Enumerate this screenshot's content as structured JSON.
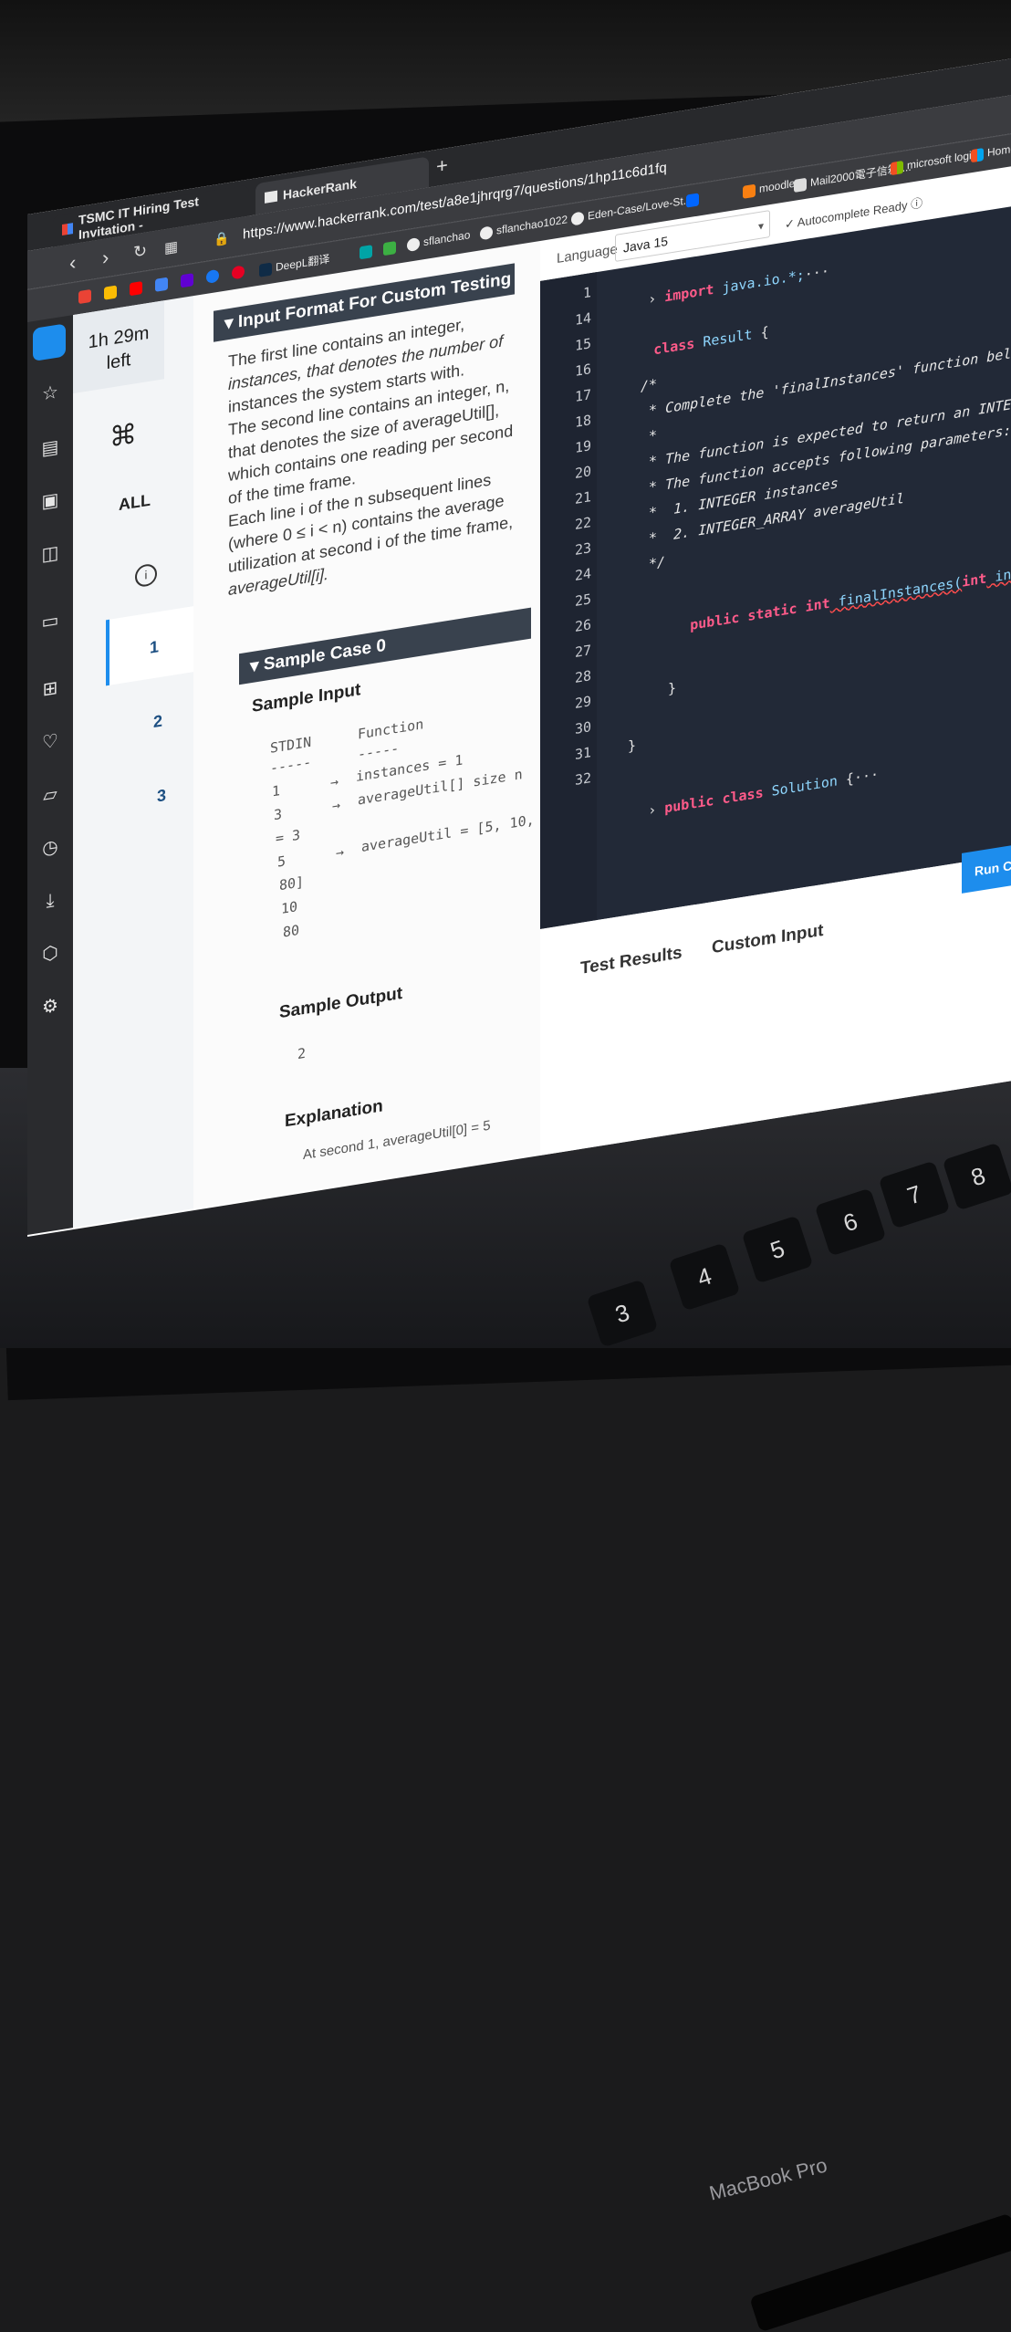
{
  "browser": {
    "tabs": [
      {
        "label": "TSMC IT Hiring Test Invitation -",
        "icon": "gmail-icon"
      },
      {
        "label": "HackerRank",
        "icon": "hackerrank-icon"
      }
    ],
    "new_tab": "+",
    "url": "https://www.hackerrank.com/test/a8e1jhrqrg7/questions/1hp11c6d1fq",
    "bookmarks": [
      "DeepL翻译",
      "sflanchao",
      "sflanchao1022",
      "Eden-Case/Love-St...",
      "moodle",
      "Mail2000電子信箱-...",
      "microsoft login",
      "Home - Visu"
    ]
  },
  "sidebar_icons": [
    "home-icon",
    "star-icon",
    "notes-icon",
    "briefcase-icon",
    "book-icon",
    "wallet-icon",
    "apps-icon",
    "heart-icon",
    "board-icon",
    "clock-icon",
    "download-icon",
    "cube-icon",
    "settings-icon",
    "more-icon"
  ],
  "hr_nav": {
    "timer": "1h 29m",
    "timer_sub": "left",
    "cmd": "⌘",
    "all": "ALL",
    "info": "i",
    "questions": [
      "1",
      "2",
      "3"
    ]
  },
  "problem": {
    "input_format_title": "Input Format For Custom Testing",
    "lines": [
      "The first line contains an integer,",
      "instances, that denotes the number of",
      "instances the system starts with.",
      "The second line contains an integer, n,",
      "that denotes the size of averageUtil[],",
      "which contains one reading per second",
      "of the time frame.",
      "Each line i of the n subsequent lines",
      "(where 0 ≤ i < n) contains the average",
      "utilization at second i of the time frame,",
      "averageUtil[i]."
    ],
    "sample_case_title": "Sample Case 0",
    "sample_input_title": "Sample Input",
    "stdin_header": "STDIN",
    "function_header": "Function",
    "dashes1": "-----",
    "dashes2": "-----",
    "stdin_rows": [
      "1",
      "3",
      "= 3",
      "5",
      "80]",
      "10",
      "80"
    ],
    "function_rows": [
      "instances = 1",
      "averageUtil[] size n",
      "averageUtil = [5, 10,"
    ],
    "arrows": [
      "→",
      "→",
      "→"
    ],
    "sample_output_title": "Sample Output",
    "sample_output_value": "2",
    "explanation_title": "Explanation",
    "explanation_text": "At second 1, averageUtil[0] = 5"
  },
  "editor": {
    "language_label": "Language",
    "language_value": "Java 15",
    "autocomplete": "Autocomplete Ready",
    "line_numbers": [
      "1",
      "14",
      "15",
      "16",
      "17",
      "18",
      "19",
      "20",
      "21",
      "22",
      "23",
      "24",
      "25",
      "26",
      "27",
      "28",
      "29",
      "30",
      "31",
      "32"
    ],
    "code": {
      "l1_kw": "import",
      "l1_rest": " java.io.*;",
      "l1_fold": "···",
      "l15_kw": "class",
      "l15_name": " Result",
      "l15_brace": " {",
      "c17": "/*",
      "c18": " * Complete the 'finalInstances' function below.",
      "c19": " *",
      "c20": " * The function is expected to return an INTEGER.",
      "c21": " * The function accepts following parameters:",
      "c22": " *  1. INTEGER instances",
      "c23": " *  2. INTEGER_ARRAY averageUtil",
      "c24": " */",
      "l25_mods": "public static int",
      "l25_fn": " finalInstances(",
      "l25_type": "int",
      "l25_params": " instances, List<Int",
      "l28": "}",
      "l30": "}",
      "l32_kw": "public class",
      "l32_name": " Solution",
      "l32_rest": " {···"
    },
    "run_button": "Run Cod",
    "bottom_tabs": [
      "Test Results",
      "Custom Input"
    ]
  },
  "laptop": {
    "brand": "MacBook Pro",
    "keys": [
      "3",
      "4",
      "5",
      "6",
      "7",
      "8",
      "+"
    ]
  }
}
